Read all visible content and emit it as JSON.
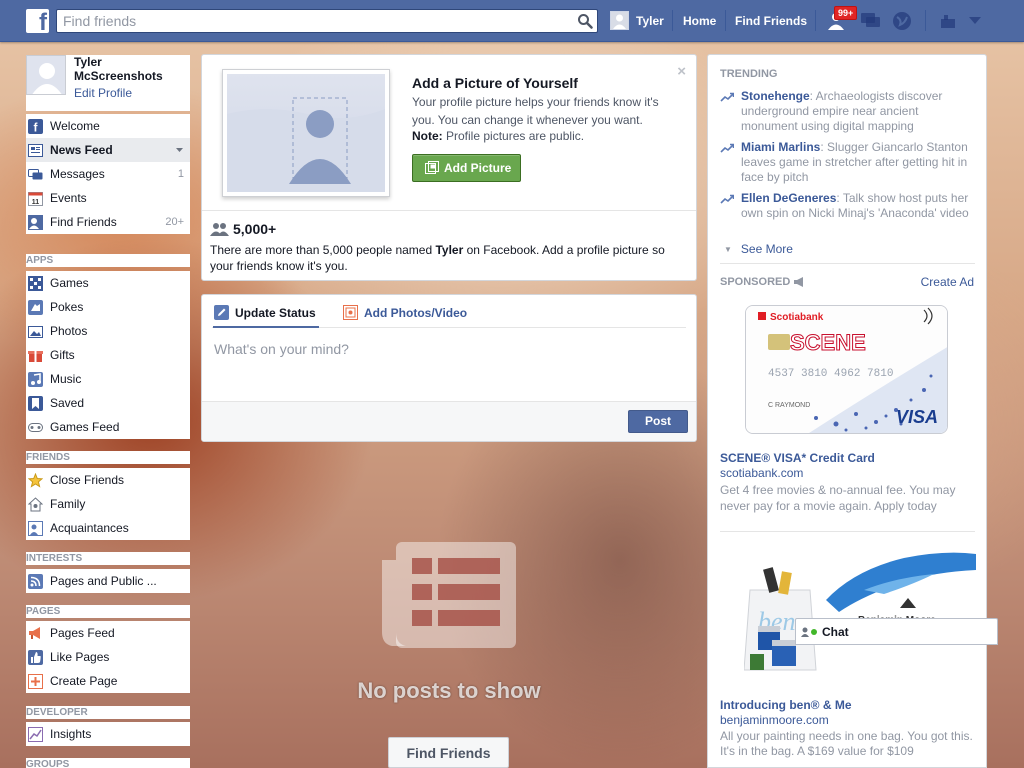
{
  "topbar": {
    "logo_letter": "f",
    "search_placeholder": "Find friends",
    "user_name": "Tyler",
    "home": "Home",
    "find_friends": "Find Friends",
    "friend_requests_badge": "99+"
  },
  "profile": {
    "name": "Tyler McScreenshots",
    "edit": "Edit Profile"
  },
  "nav": {
    "main": [
      {
        "label": "Welcome",
        "icon": "welcome-icon"
      },
      {
        "label": "News Feed",
        "icon": "news-feed-icon"
      },
      {
        "label": "Messages",
        "icon": "messages-icon",
        "count": "1"
      },
      {
        "label": "Events",
        "icon": "events-icon",
        "icon_text": "11"
      },
      {
        "label": "Find Friends",
        "icon": "find-friends-icon",
        "count": "20+"
      }
    ],
    "apps_heading": "APPS",
    "apps": [
      {
        "label": "Games",
        "icon": "games-icon"
      },
      {
        "label": "Pokes",
        "icon": "pokes-icon"
      },
      {
        "label": "Photos",
        "icon": "photos-icon"
      },
      {
        "label": "Gifts",
        "icon": "gifts-icon"
      },
      {
        "label": "Music",
        "icon": "music-icon"
      },
      {
        "label": "Saved",
        "icon": "saved-icon"
      },
      {
        "label": "Games Feed",
        "icon": "games-feed-icon"
      }
    ],
    "friends_heading": "FRIENDS",
    "friends": [
      {
        "label": "Close Friends",
        "icon": "star-icon"
      },
      {
        "label": "Family",
        "icon": "family-icon"
      },
      {
        "label": "Acquaintances",
        "icon": "acquaintances-icon"
      }
    ],
    "interests_heading": "INTERESTS",
    "interests": [
      {
        "label": "Pages and Public ...",
        "icon": "rss-icon"
      }
    ],
    "pages_heading": "PAGES",
    "pages": [
      {
        "label": "Pages Feed",
        "icon": "megaphone-icon"
      },
      {
        "label": "Like Pages",
        "icon": "thumbs-up-icon"
      },
      {
        "label": "Create Page",
        "icon": "create-page-icon"
      }
    ],
    "developer_heading": "DEVELOPER",
    "developer": [
      {
        "label": "Insights",
        "icon": "insights-icon"
      }
    ],
    "groups_heading": "GROUPS"
  },
  "profile_prompt": {
    "title": "Add a Picture of Yourself",
    "description": "Your profile picture helps your friends know it's you. You can change it whenever you want.",
    "note_label": "Note:",
    "note_text": " Profile pictures are public.",
    "button": "Add Picture",
    "close": "×",
    "count": "5,000+",
    "footnote_pre": "There are more than 5,000 people named ",
    "footnote_name": "Tyler",
    "footnote_post": " on Facebook. Add a profile picture so your friends know it's you."
  },
  "composer": {
    "tab_status": "Update Status",
    "tab_photos": "Add Photos/Video",
    "placeholder": "What's on your mind?",
    "post": "Post"
  },
  "feed": {
    "empty_text": "No posts to show",
    "find_friends_button": "Find Friends"
  },
  "trending": {
    "heading": "TRENDING",
    "items": [
      {
        "topic": "Stonehenge",
        "text": ": Archaeologists discover underground empire near ancient monument using digital mapping"
      },
      {
        "topic": "Miami Marlins",
        "text": ": Slugger Giancarlo Stanton leaves game in stretcher after getting hit in face by pitch"
      },
      {
        "topic": "Ellen DeGeneres",
        "text": ": Talk show host puts her own spin on Nicki Minaj's 'Anaconda' video"
      }
    ],
    "see_more": "See More"
  },
  "sponsored": {
    "heading": "SPONSORED",
    "create_ad": "Create Ad",
    "ads": [
      {
        "title": "SCENE® VISA* Credit Card",
        "url": "scotiabank.com",
        "description": "Get 4 free movies & no-annual fee. You may never pay for a movie again. Apply today",
        "image_brand": "Scotiabank",
        "image_card_name": "SCENE",
        "image_card_number": "4537 3810 4962 7810",
        "image_card_holder": "C RAYMOND",
        "image_card_network": "VISA"
      },
      {
        "title": "Introducing ben® & Me",
        "url": "benjaminmoore.com",
        "description": "All your painting needs in one bag. You got this. It's in the bag. A $169 value for $109",
        "image_brand": "Benjamin Moore",
        "image_logo_text": "ben"
      }
    ]
  },
  "chat": {
    "label": "Chat"
  }
}
